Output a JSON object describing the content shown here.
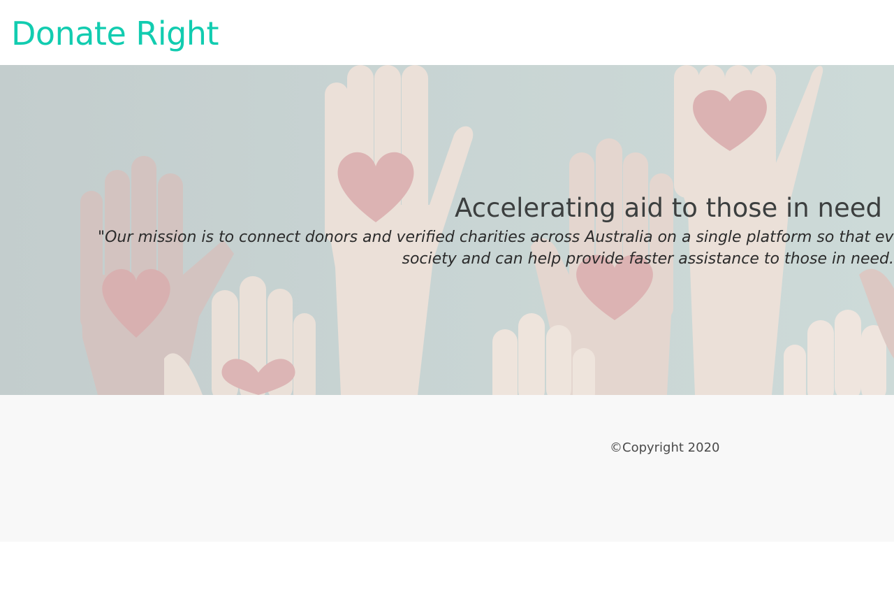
{
  "header": {
    "brand": "Donate Right"
  },
  "hero": {
    "title": "Accelerating aid to those in need",
    "mission_line1": "\"Our mission is to connect donors and verified charities across Australia on a single platform so that every",
    "mission_line2": "society and can help provide faster assistance to those in need.",
    "background_image": "raised-hands-with-hearts-illustration"
  },
  "footer": {
    "copyright": "©Copyright 2020"
  },
  "colors": {
    "brand": "#12ccb0",
    "hero_bg": "#c8d4d3",
    "heart": "#dcb5b5",
    "hand_light": "#ebe0d8",
    "hand_dark": "#d7c6c1",
    "footer_bg": "#f8f8f8",
    "title_text": "#3c3f3f"
  }
}
